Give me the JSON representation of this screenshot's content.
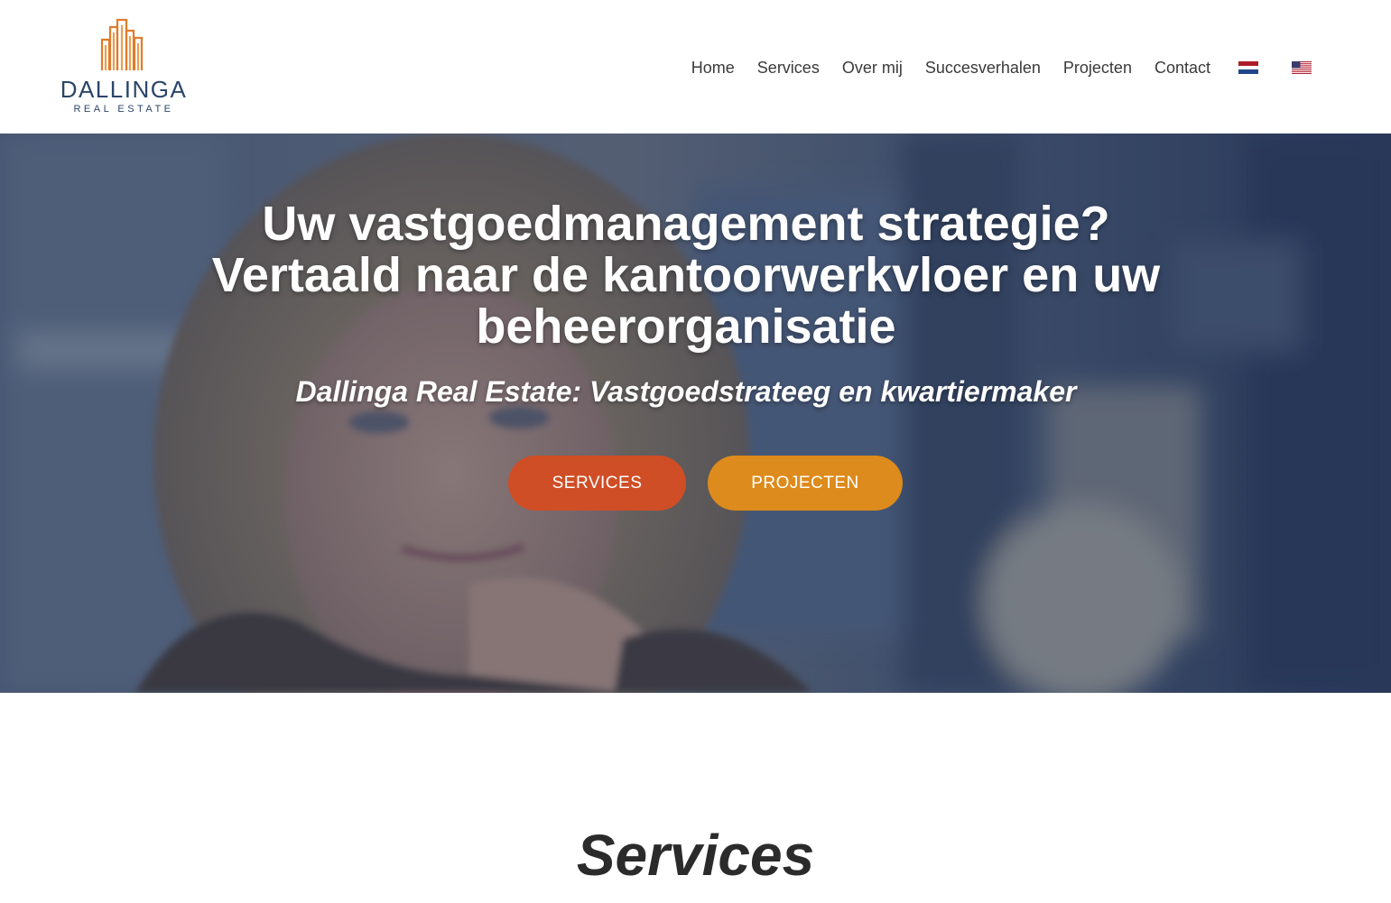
{
  "brand": {
    "name": "DALLINGA",
    "tagline": "REAL ESTATE",
    "primary_color": "#2c4569",
    "accent_color": "#e07b2a"
  },
  "nav": {
    "items": [
      {
        "label": "Home"
      },
      {
        "label": "Services"
      },
      {
        "label": "Over mij"
      },
      {
        "label": "Succesverhalen"
      },
      {
        "label": "Projecten"
      },
      {
        "label": "Contact"
      }
    ],
    "languages": [
      {
        "icon": "dutch-flag-icon"
      },
      {
        "icon": "us-flag-icon"
      }
    ]
  },
  "hero": {
    "title_line1": "Uw vastgoedmanagement strategie?",
    "title_line2": "Vertaald naar de kantoorwerkvloer en uw beheerorganisatie",
    "subtitle": "Dallinga Real Estate: Vastgoedstrateeg en kwartiermaker",
    "buttons": {
      "services": {
        "label": "SERVICES",
        "color": "#cf4e25"
      },
      "projecten": {
        "label": "PROJECTEN",
        "color": "#dd8b1c"
      }
    }
  },
  "services_section": {
    "title": "Services"
  }
}
